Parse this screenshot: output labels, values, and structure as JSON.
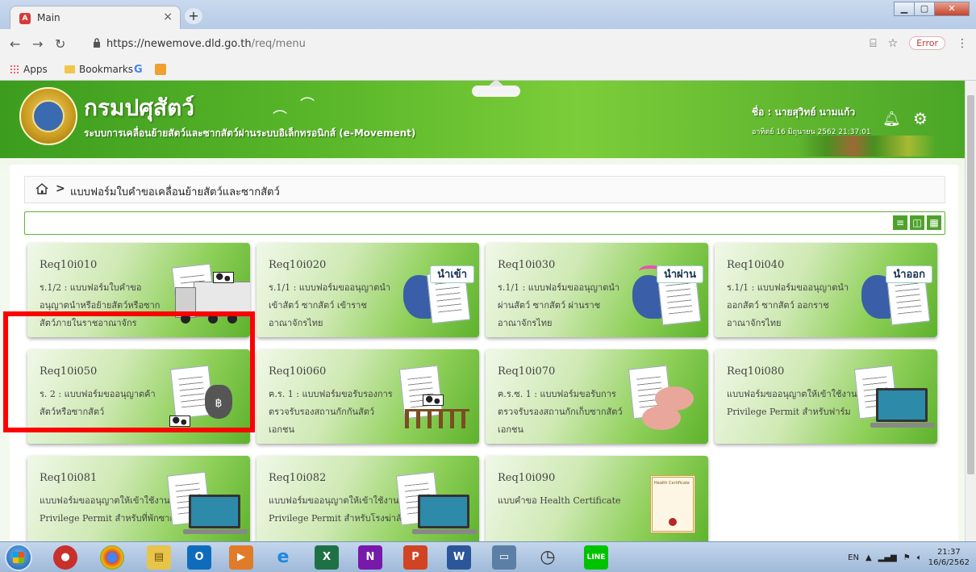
{
  "browser": {
    "tab_title": "Main",
    "tab_close": "×",
    "new_tab": "+",
    "url_host": "https://newemove.dld.go.th",
    "url_path": "/req/menu",
    "error_label": "Error",
    "bookmarks": [
      "Apps",
      "Bookmarks"
    ]
  },
  "banner": {
    "dept_name": "กรมปศุสัตว์",
    "system_name": "ระบบการเคลื่อนย้ายสัตว์และซากสัตว์ผ่านระบบอิเล็กทรอนิกส์ (e-Movement)",
    "user": "ชื่อ : นายสุวิทย์ นามแก้ว",
    "datetime": "อาทิตย์ 16 มิถุนายน 2562 21:37:01"
  },
  "breadcrumb": {
    "separator": ">",
    "current": "แบบฟอร์มใบคำขอเคลื่อนย้ายสัตว์และซากสัตว์"
  },
  "view_buttons": [
    "≡",
    "◫",
    "▦"
  ],
  "cards": [
    {
      "code": "Req10i010",
      "desc": "ร.1/2 : แบบฟอร์มใบคำขออนุญาตนำหรือย้ายสัตว์หรือซากสัตว์ภายในราชอาณาจักร",
      "badge": ""
    },
    {
      "code": "Req10i020",
      "desc": "ร.1/1 : แบบฟอร์มขออนุญาตนำเข้าสัตว์ ซากสัตว์ เข้าราชอาณาจักรไทย",
      "badge": "นำเข้า"
    },
    {
      "code": "Req10i030",
      "desc": "ร.1/1 : แบบฟอร์มขออนุญาตนำผ่านสัตว์ ซากสัตว์ ผ่านราชอาณาจักรไทย",
      "badge": "นำผ่าน"
    },
    {
      "code": "Req10i040",
      "desc": "ร.1/1 : แบบฟอร์มขออนุญาตนำออกสัตว์ ซากสัตว์ ออกราชอาณาจักรไทย",
      "badge": "นำออก"
    },
    {
      "code": "Req10i050",
      "desc": "ร. 2 : แบบฟอร์มขออนุญาตค้าสัตว์หรือซากสัตว์",
      "badge": ""
    },
    {
      "code": "Req10i060",
      "desc": "ฅ.ร. 1 : แบบฟอร์มขอรับรองการตรวจรับรองสถานกักกันสัตว์เอกชน",
      "badge": ""
    },
    {
      "code": "Req10i070",
      "desc": "ฅ.ร.ซ. 1 : แบบฟอร์มขอรับการตรวจรับรองสถานกักเก็บซากสัตว์เอกชน",
      "badge": ""
    },
    {
      "code": "Req10i080",
      "desc": "แบบฟอร์มขออนุญาตให้เข้าใช้งาน Privilege Permit สำหรับฟาร์ม",
      "badge": ""
    },
    {
      "code": "Req10i081",
      "desc": "แบบฟอร์มขออนุญาตให้เข้าใช้งาน Privilege Permit สำหรับที่พักซากสัตว์",
      "badge": ""
    },
    {
      "code": "Req10i082",
      "desc": "แบบฟอร์มขออนุญาตให้เข้าใช้งาน Privilege Permit สำหรับโรงฆ่าสัตว์",
      "badge": ""
    },
    {
      "code": "Req10i090",
      "desc": "แบบคำขอ Health Certificate",
      "badge": ""
    }
  ],
  "certificate_title": "Health Certificate",
  "taskbar": {
    "lang": "EN",
    "time": "21:37",
    "date": "16/6/2562"
  }
}
